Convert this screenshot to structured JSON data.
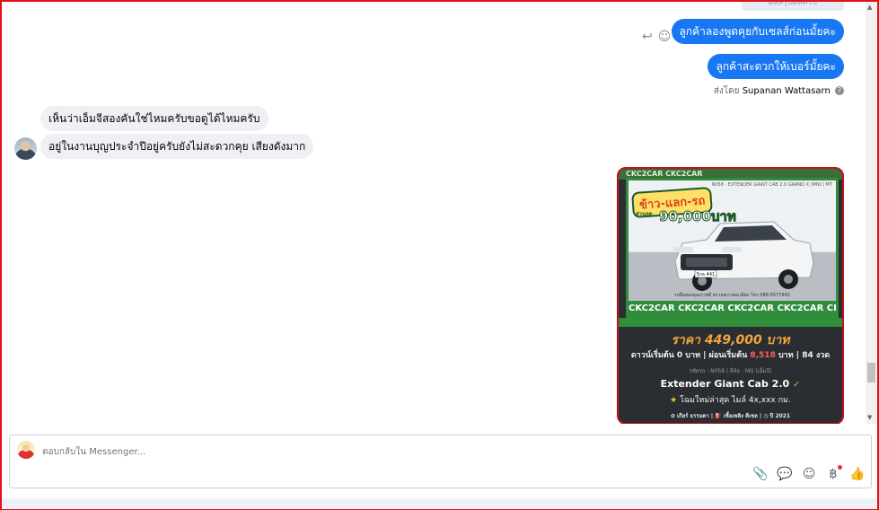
{
  "conversation": {
    "top_partial_text": "ผลสรุปผลครับ",
    "outgoing_messages": [
      {
        "text": "ลูกค้าลองพูดคุยกับเซลส์ก่อนมั้ยคะ"
      },
      {
        "text": "ลูกค้าสะดวกให้เบอร์มั้ยคะ"
      }
    ],
    "sent_by_prefix": "ส่งโดย",
    "sent_by_name": "Supanan Wattasarn",
    "sent_by_help": "?",
    "incoming_messages": [
      {
        "text": "เห็นว่าเอ็มจีสองคันใช่ไหมครับขอดูได้ไหมครับ"
      },
      {
        "text": "อยู่ในงานบุญประจำปีอยู่ครับยังไม่สะดวกคุย เสียงดังมาก"
      }
    ]
  },
  "message_actions": {
    "reply_icon": "↩",
    "react_icon": "☺"
  },
  "ad_card": {
    "top_strip": "CKC2CAR CKC2CAR",
    "sku_line": "N058 · EXTENDER GIANT CAB 2.0 GRAND X (MNC) MT",
    "badge": "ข้าว-แลก-รถ",
    "discount_label": "ส่วนลด",
    "discount_amount": "90,000บาท",
    "contact_line": "รถมือสองคุณภาพดี ตรวจสภาพละเอียด โทร 088-5577992",
    "marquee": "CKC2CAR CKC2CAR CKC2CAR CKC2CAR CKC2",
    "plate": "5กธ 441",
    "price": "ราคา 449,000 บาท",
    "terms_prefix": "ดาวน์เริ่มต้น 0 บาท | ผ่อนเริ่มต้น ",
    "terms_highlight": "8,518",
    "terms_suffix": " บาท | 84 งวด",
    "meta_line": "รหัสรถ : N058 | ยี่ห้อ : MG (เอ็มจี)",
    "model": "Extender Giant Cab 2.0",
    "model_check": "✓",
    "subtitle": "โฉมใหม่ล่าสุด ไมล์ 4x,xxx กม.",
    "subtitle_star": "★",
    "specs": "✿ เกียร์ ธรรมดา   |   ⛽ เชื้อเพลิง ดีเซล   |   ◷ ปี 2021"
  },
  "scrollbar": {
    "up": "▲",
    "down": "▼"
  },
  "composer": {
    "placeholder": "ตอบกลับใน Messenger...",
    "tools": {
      "attach": "📎",
      "saved_reply": "💬",
      "emoji": "☺",
      "payment": "฿",
      "like": "👍"
    }
  }
}
